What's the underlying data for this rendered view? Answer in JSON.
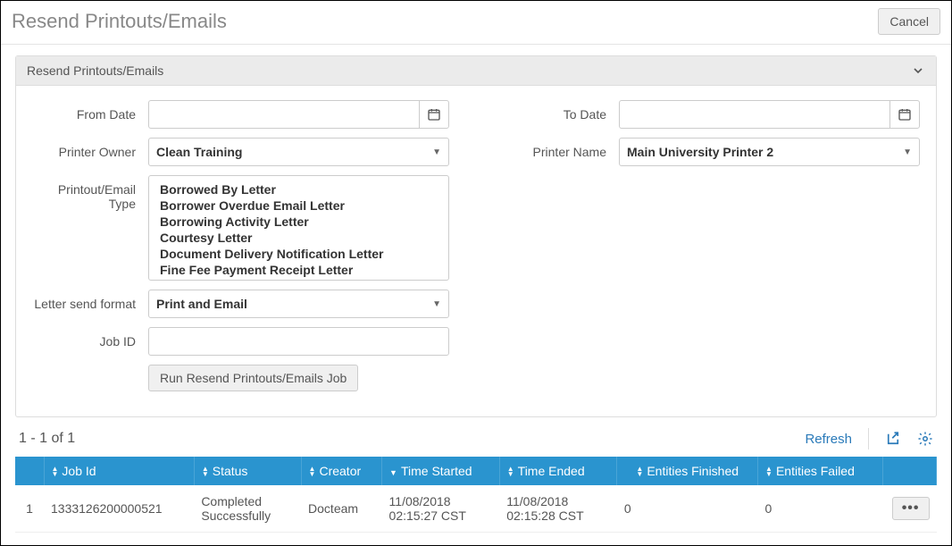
{
  "header": {
    "title": "Resend Printouts/Emails",
    "cancel_label": "Cancel"
  },
  "panel": {
    "title": "Resend Printouts/Emails"
  },
  "form": {
    "from_date": {
      "label": "From Date",
      "value": ""
    },
    "to_date": {
      "label": "To Date",
      "value": ""
    },
    "printer_owner": {
      "label": "Printer Owner",
      "value": "Clean Training"
    },
    "printer_name": {
      "label": "Printer Name",
      "value": "Main University Printer 2"
    },
    "printout_type": {
      "label": "Printout/Email Type",
      "options": [
        "Borrowed By Letter",
        "Borrower Overdue Email Letter",
        "Borrowing Activity Letter",
        "Courtesy Letter",
        "Document Delivery Notification Letter",
        "Fine Fee Payment Receipt Letter"
      ]
    },
    "letter_format": {
      "label": "Letter send format",
      "value": "Print and Email"
    },
    "job_id": {
      "label": "Job ID",
      "value": ""
    },
    "run_button": "Run Resend Printouts/Emails Job"
  },
  "table": {
    "range": "1 - 1 of 1",
    "refresh_label": "Refresh",
    "columns": {
      "job_id": "Job Id",
      "status": "Status",
      "creator": "Creator",
      "time_started": "Time Started",
      "time_ended": "Time Ended",
      "entities_finished": "Entities Finished",
      "entities_failed": "Entities Failed"
    },
    "rows": [
      {
        "index": "1",
        "job_id": "1333126200000521",
        "status": "Completed Successfully",
        "creator": "Docteam",
        "time_started": "11/08/2018 02:15:27 CST",
        "time_ended": "11/08/2018 02:15:28 CST",
        "entities_finished": "0",
        "entities_failed": "0"
      }
    ]
  }
}
